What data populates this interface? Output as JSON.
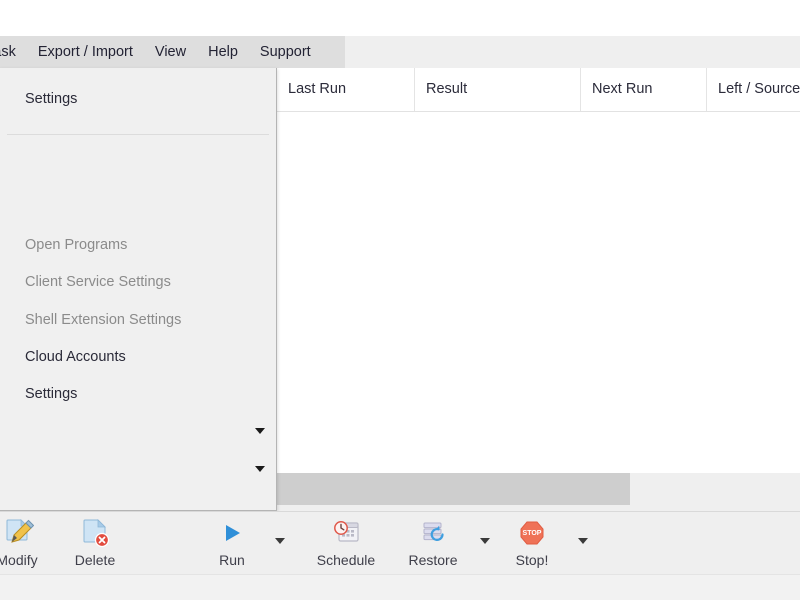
{
  "menubar": {
    "items": [
      {
        "label": "Task",
        "truncated": true
      },
      {
        "label": "Export / Import"
      },
      {
        "label": "View"
      },
      {
        "label": "Help"
      },
      {
        "label": "Support"
      }
    ]
  },
  "dropdown": {
    "open_for": "View",
    "items": [
      {
        "label": "Settings",
        "state": "enabled",
        "arrow": false
      },
      {
        "label": "Open Programs",
        "state": "disabled",
        "arrow": false
      },
      {
        "label": "Client Service Settings",
        "state": "disabled",
        "arrow": false
      },
      {
        "label": "Shell Extension Settings",
        "state": "disabled",
        "arrow": false
      },
      {
        "label": "Cloud Accounts",
        "state": "enabled",
        "arrow": false
      },
      {
        "label": "Settings",
        "state": "enabled",
        "arrow": false
      },
      {
        "label": "",
        "state": "enabled",
        "arrow": true
      },
      {
        "label": "",
        "state": "enabled",
        "arrow": true
      }
    ]
  },
  "list": {
    "columns": [
      {
        "label": "Last Run"
      },
      {
        "label": "Result"
      },
      {
        "label": "Next Run"
      },
      {
        "label": "Left / Source"
      }
    ],
    "rows": []
  },
  "toolbar": {
    "buttons": [
      {
        "label": "Modify",
        "icon": "document-pencil-icon",
        "caret": false
      },
      {
        "label": "Delete",
        "icon": "document-delete-icon",
        "caret": false
      },
      {
        "label": "Run",
        "icon": "play-icon",
        "caret": true
      },
      {
        "label": "Schedule",
        "icon": "calendar-clock-icon",
        "caret": false
      },
      {
        "label": "Restore",
        "icon": "restore-layers-icon",
        "caret": true
      },
      {
        "label": "Stop!",
        "icon": "stop-sign-icon",
        "caret": true
      }
    ],
    "stop_icon_text": "STOP"
  },
  "colors": {
    "menubar_bg": "#dedede",
    "panel_bg": "#efefef",
    "dropdown_bg": "#f0f0f0",
    "grey_bar": "#cecece",
    "accent_blue": "#3f9fe0",
    "accent_red": "#e8553f",
    "text_dark": "#2a2a38",
    "text_disabled": "#8b8b8b"
  }
}
